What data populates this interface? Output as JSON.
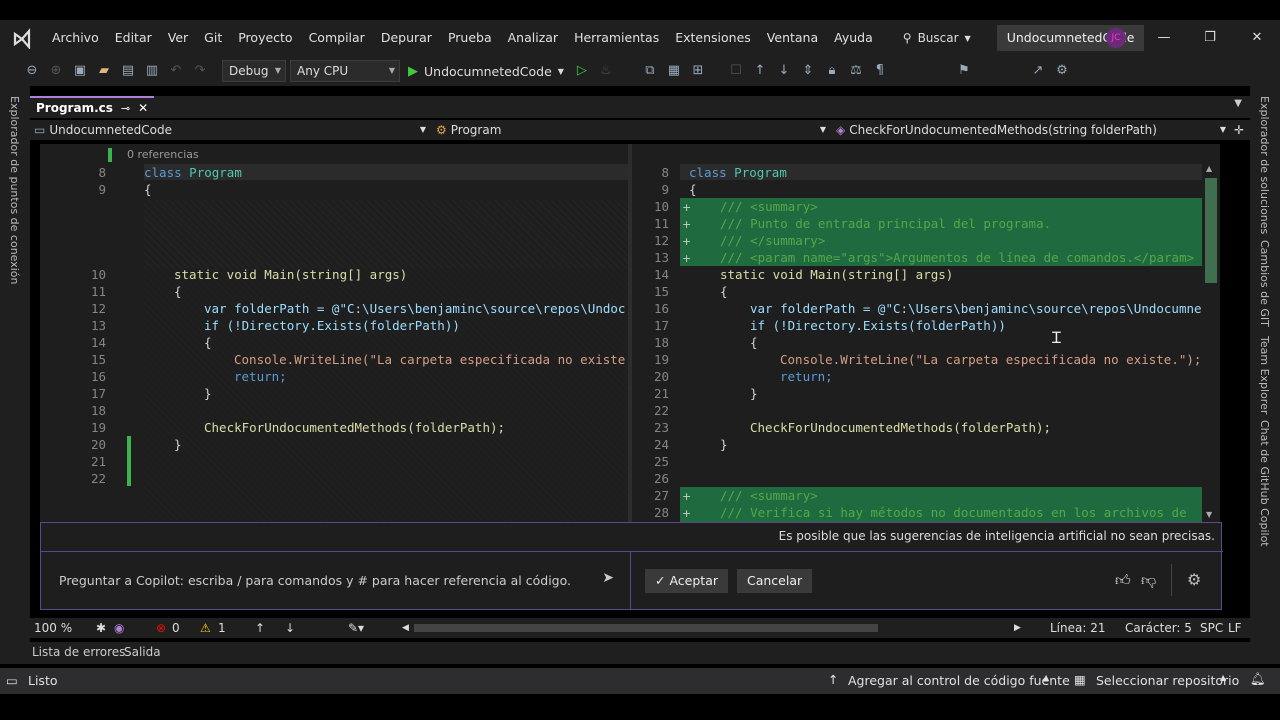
{
  "menubar": {
    "items": [
      "Archivo",
      "Editar",
      "Ver",
      "Git",
      "Proyecto",
      "Compilar",
      "Depurar",
      "Prueba",
      "Analizar",
      "Herramientas",
      "Extensiones",
      "Ventana",
      "Ayuda"
    ],
    "search_label": "Buscar",
    "solution_name": "UndocumnetedCode",
    "avatar_initials": "JC"
  },
  "toolbar": {
    "configuration": "Debug",
    "platform": "Any CPU",
    "run_target": "UndocumnetedCode"
  },
  "side_panels": {
    "left": "Explorador de puntos de conexión",
    "right": [
      "Explorador de soluciones",
      "Cambios de GIT",
      "Team Explorer",
      "Chat de GitHub Copilot"
    ]
  },
  "document_tab": {
    "name": "Program.cs"
  },
  "navbar": {
    "project": "UndocumnetedCode",
    "class": "Program",
    "member": "CheckForUndocumentedMethods(string folderPath)"
  },
  "editor": {
    "codelens": "0 referencias",
    "left_line_numbers": [
      "8",
      "9",
      "10",
      "11",
      "12",
      "13",
      "14",
      "15",
      "16",
      "17",
      "18",
      "19",
      "20",
      "21",
      "22"
    ],
    "right_line_numbers": [
      "8",
      "9",
      "10",
      "11",
      "12",
      "13",
      "14",
      "15",
      "16",
      "17",
      "18",
      "19",
      "20",
      "21",
      "22",
      "23",
      "24",
      "25",
      "26",
      "27",
      "28"
    ],
    "code": {
      "class_kw": "class",
      "class_name": "Program",
      "open_brace": "{",
      "close_brace": "}",
      "doc_summary_open": "/// <summary>",
      "doc_summary_text": "/// Punto de entrada principal del programa.",
      "doc_summary_close": "/// </summary>",
      "doc_param": "/// <param name=\"args\">Argumentos de línea de comandos.</param>",
      "main_sig": "static void Main(string[] args)",
      "var_line": "var folderPath = @\"C:\\Users\\benjaminc\\source\\repos\\Undocumne",
      "var_line_left": "var folderPath = @\"C:\\Users\\benjaminc\\source\\repos\\Undoc",
      "if_line": "if (!Directory.Exists(folderPath))",
      "console_line": "Console.WriteLine(\"La carpeta especificada no existe.\");",
      "console_line_left": "Console.WriteLine(\"La carpeta especificada no existe",
      "return_line": "return;",
      "call_line": "CheckForUndocumentedMethods(folderPath);",
      "doc2_summary_open": "/// <summary>",
      "doc2_summary_text": "/// Verifica si hay métodos no documentados en los archivos de"
    }
  },
  "copilot": {
    "warning": "Es posible que las sugerencias de inteligencia artificial no sean precisas.",
    "input_placeholder": "Preguntar a Copilot: escriba / para comandos y # para hacer referencia al código.",
    "accept_label": "Aceptar",
    "cancel_label": "Cancelar"
  },
  "statusline": {
    "zoom": "100 %",
    "errors": "0",
    "warnings": "1",
    "line": "Línea: 21",
    "char": "Carácter: 5",
    "spacing": "SPC",
    "eol": "LF"
  },
  "bottom_tabs": [
    "Lista de errores",
    "Salida"
  ],
  "statusbar": {
    "ready": "Listo",
    "add_source_control": "Agregar al control de código fuente",
    "select_repo": "Seleccionar repositorio"
  }
}
